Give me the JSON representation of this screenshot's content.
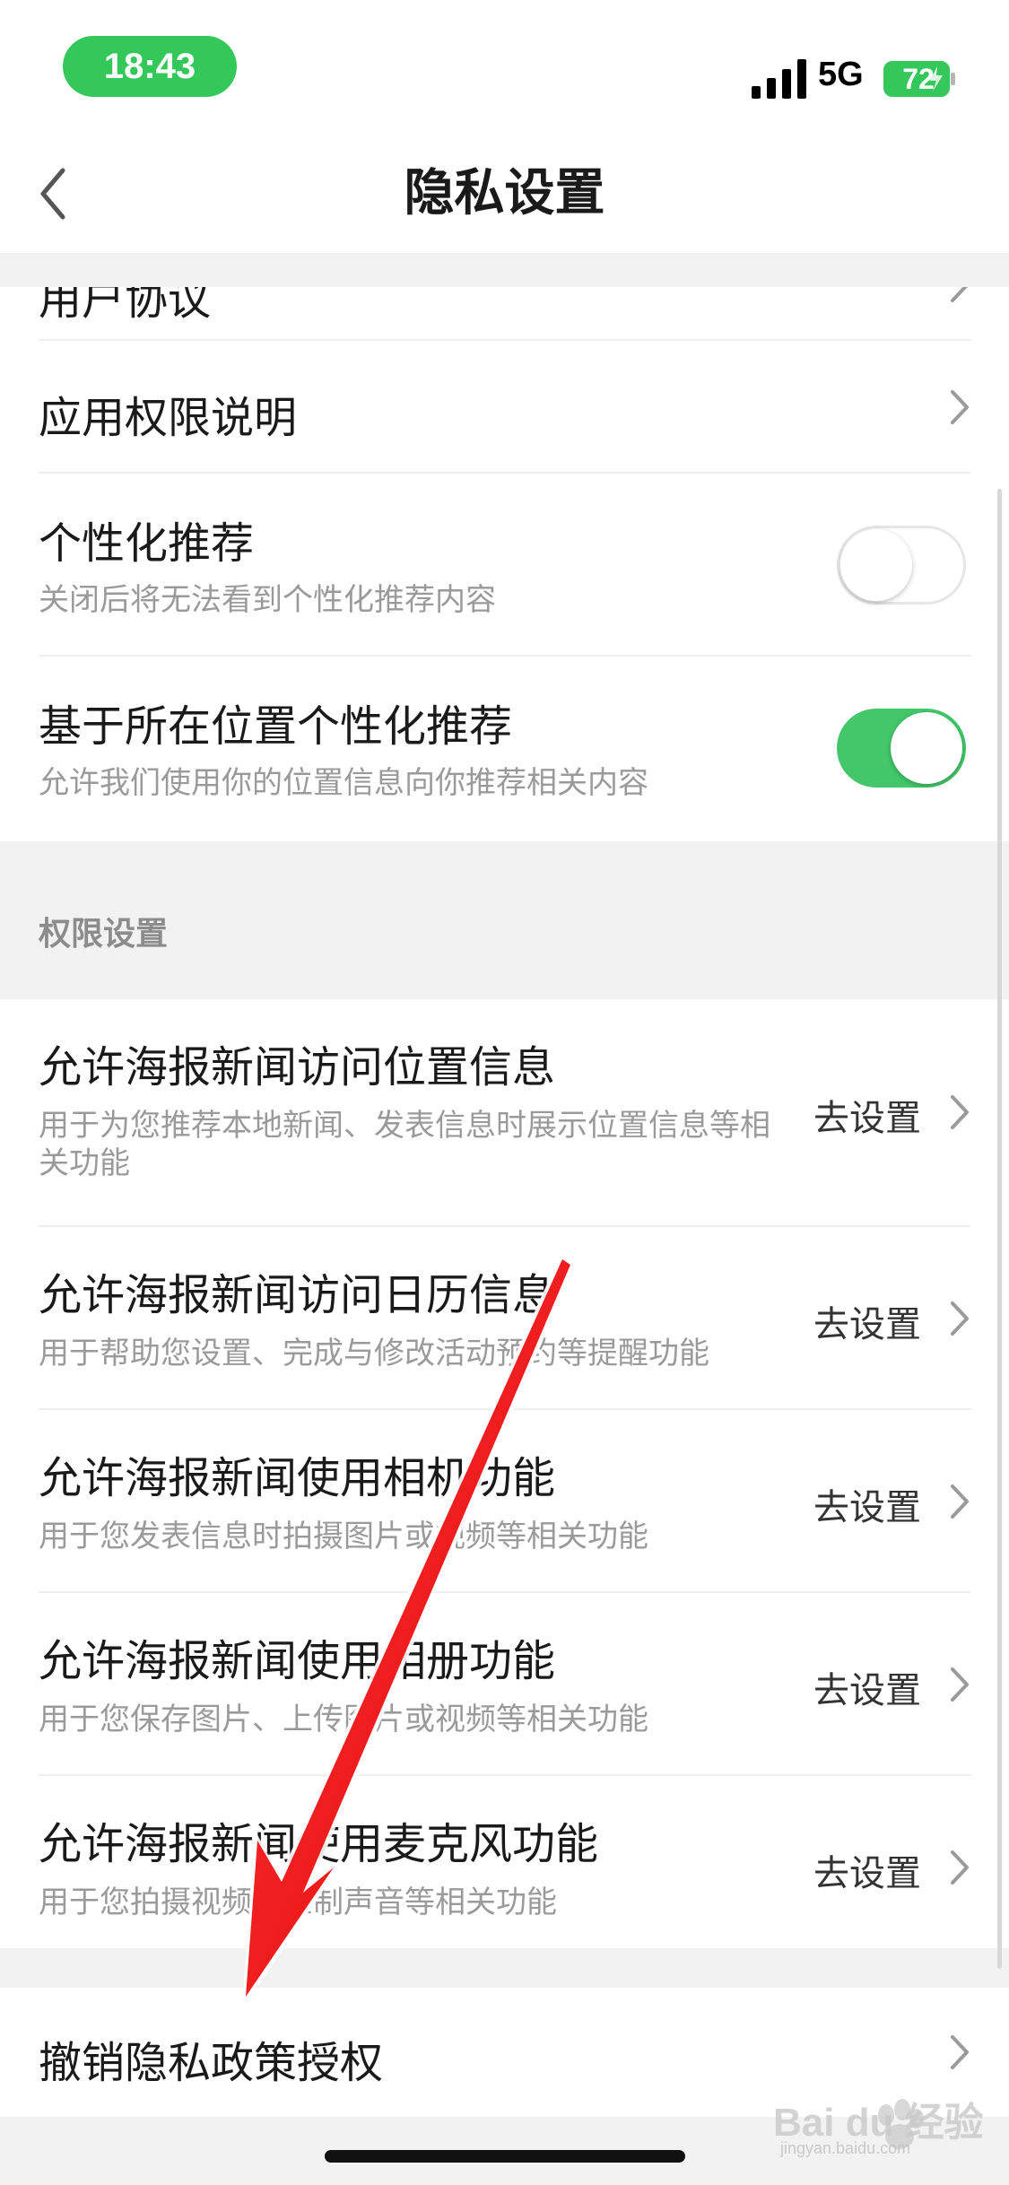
{
  "status_bar": {
    "time": "18:43",
    "network": "5G",
    "battery": "72"
  },
  "nav": {
    "title": "隐私设置"
  },
  "top_section": {
    "partial_row_title": "用户协议",
    "rows": [
      {
        "title": "应用权限说明"
      },
      {
        "title": "个性化推荐",
        "subtitle": "关闭后将无法看到个性化推荐内容",
        "toggle": "off"
      },
      {
        "title": "基于所在位置个性化推荐",
        "subtitle": "允许我们使用你的位置信息向你推荐相关内容",
        "toggle": "on"
      }
    ]
  },
  "permissions_section": {
    "header": "权限设置",
    "action_label": "去设置",
    "rows": [
      {
        "title": "允许海报新闻访问位置信息",
        "subtitle": "用于为您推荐本地新闻、发表信息时展示位置信息等相关功能"
      },
      {
        "title": "允许海报新闻访问日历信息",
        "subtitle": "用于帮助您设置、完成与修改活动预约等提醒功能"
      },
      {
        "title": "允许海报新闻使用相机功能",
        "subtitle": "用于您发表信息时拍摄图片或视频等相关功能"
      },
      {
        "title": "允许海报新闻使用相册功能",
        "subtitle": "用于您保存图片、上传图片或视频等相关功能"
      },
      {
        "title": "允许海报新闻使用麦克风功能",
        "subtitle": "用于您拍摄视频或录制声音等相关功能"
      }
    ]
  },
  "bottom_section": {
    "rows": [
      {
        "title": "撤销隐私政策授权"
      }
    ]
  },
  "watermark": {
    "brand": "Bai du 经验",
    "url": "jingyan.baidu.com"
  },
  "colors": {
    "accent_green": "#43c76a",
    "status_green": "#34c759",
    "annotation_red": "#ee1111"
  }
}
